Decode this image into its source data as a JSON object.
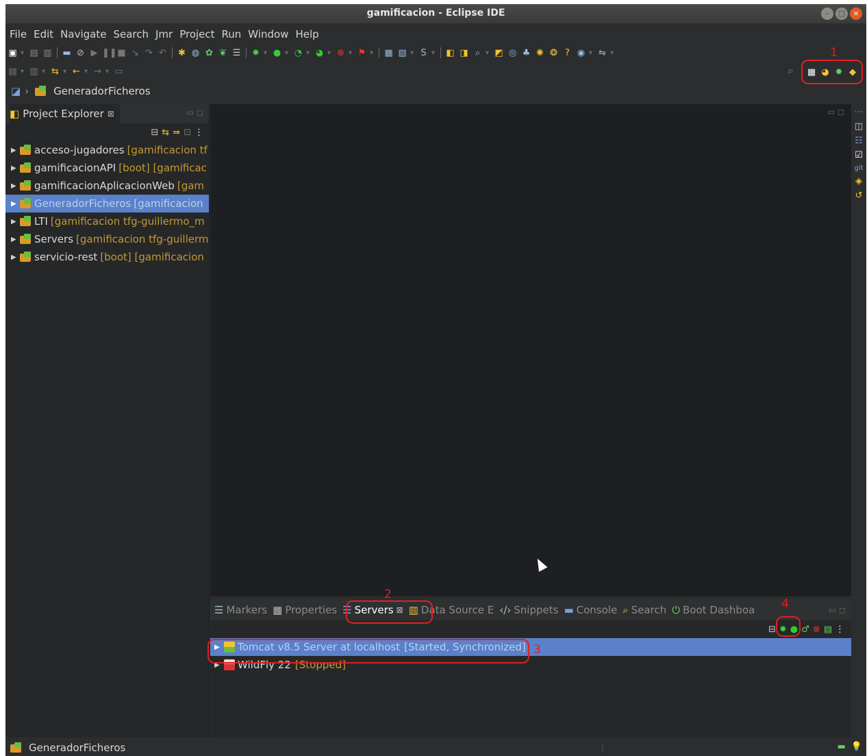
{
  "window": {
    "title": "gamificacion - Eclipse IDE"
  },
  "menu": [
    "File",
    "Edit",
    "Navigate",
    "Search",
    "Jmr",
    "Project",
    "Run",
    "Window",
    "Help"
  ],
  "breadcrumb": {
    "item": "GeneradorFicheros"
  },
  "project_explorer": {
    "title": "Project Explorer",
    "items": [
      {
        "name": "acceso-jugadores",
        "decoration": "[gamificacion tf"
      },
      {
        "name": "gamificacionAPI",
        "decoration": "[boot] [gamificac"
      },
      {
        "name": "gamificacionAplicacionWeb",
        "decoration": "[gam"
      },
      {
        "name": "GeneradorFicheros",
        "decoration": "[gamificacion"
      },
      {
        "name": "LTI",
        "decoration": "[gamificacion tfg-guillermo_m"
      },
      {
        "name": "Servers",
        "decoration": "[gamificacion tfg-guillerm"
      },
      {
        "name": "servicio-rest",
        "decoration": "[boot] [gamificacion"
      }
    ],
    "selected": "GeneradorFicheros"
  },
  "bottom_tabs": [
    "Markers",
    "Properties",
    "Servers",
    "Data Source E",
    "Snippets",
    "Console",
    "Search",
    "Boot Dashboa"
  ],
  "active_bottom_tab": "Servers",
  "servers": [
    {
      "name": "Tomcat v8.5 Server at localhost",
      "state": "[Started, Synchronized]"
    },
    {
      "name": "WildFly 22",
      "state": "[Stopped]"
    }
  ],
  "annotations": [
    "1",
    "2",
    "3",
    "4"
  ],
  "status_bar": {
    "text": "GeneradorFicheros"
  },
  "colors": {
    "selection": "#5a81c9",
    "annotation": "#e02020",
    "decoration": "#c49a32"
  }
}
